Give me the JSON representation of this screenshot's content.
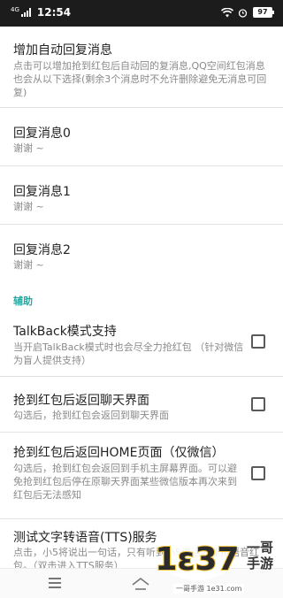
{
  "status_bar": {
    "network": "4G",
    "time": "12:54",
    "battery": "97"
  },
  "prefs": {
    "auto_reply": {
      "title": "增加自动回复消息",
      "summary": "点击可以增加抢到红包后自动回的复消息,QQ空间红包消息也会从以下选择(剩余3个消息时不允许删除避免无消息可回复)"
    },
    "reply0": {
      "title": "回复消息0",
      "summary": "谢谢 ~"
    },
    "reply1": {
      "title": "回复消息1",
      "summary": "谢谢 ~"
    },
    "reply2": {
      "title": "回复消息2",
      "summary": "谢谢 ~"
    }
  },
  "section_assist": {
    "label": "辅助"
  },
  "assist": {
    "talkback": {
      "title": "TalkBack模式支持",
      "summary": "当开启TalkBack模式时也会尽全力抢红包 （针对微信为盲人提供支持）",
      "checked": false
    },
    "back_chat": {
      "title": "抢到红包后返回聊天界面",
      "summary": "勾选后，抢到红包会返回到聊天界面",
      "checked": false
    },
    "back_home": {
      "title": "抢到红包后返回HOME页面（仅微信）",
      "summary": "勾选后，抢到红包会返回到手机主屏幕界面。可以避免抢到红包后停在原聊天界面某些微信版本再次来到红包后无法感知",
      "checked": false
    },
    "tts": {
      "title": "测试文字转语音(TTS)服务",
      "summary": "点击，小5将说出一句话，只有听到小5说话才能抢语音红包。（双击进入TTS服务）"
    }
  },
  "watermark": {
    "logo_text": "1ε37",
    "brand": "一哥手游",
    "domain": "一哥手游 1e31.com"
  }
}
